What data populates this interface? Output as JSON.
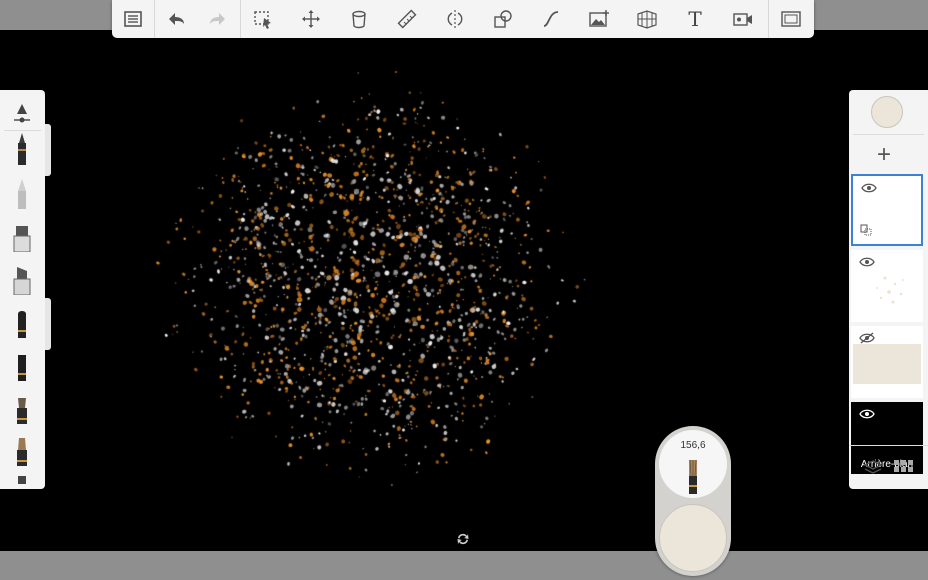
{
  "toolbar": {
    "items": [
      "menu",
      "undo",
      "redo",
      "selection",
      "transform",
      "ruler",
      "stroke-style",
      "symmetry",
      "shape",
      "curve",
      "image",
      "perspective",
      "text",
      "record",
      "fullscreen"
    ],
    "text_tool_label": "T"
  },
  "puck": {
    "brush_size": "156,6",
    "color": "#ece6da"
  },
  "layers": {
    "current_color": "#ece6da",
    "add_label": "+",
    "background_label": "Arrière-plan"
  },
  "colors": {
    "accent": "#3b82d6",
    "panel": "#f4f4f4",
    "paint_orange": "#e8912c",
    "paint_white": "#f2f2f2"
  }
}
